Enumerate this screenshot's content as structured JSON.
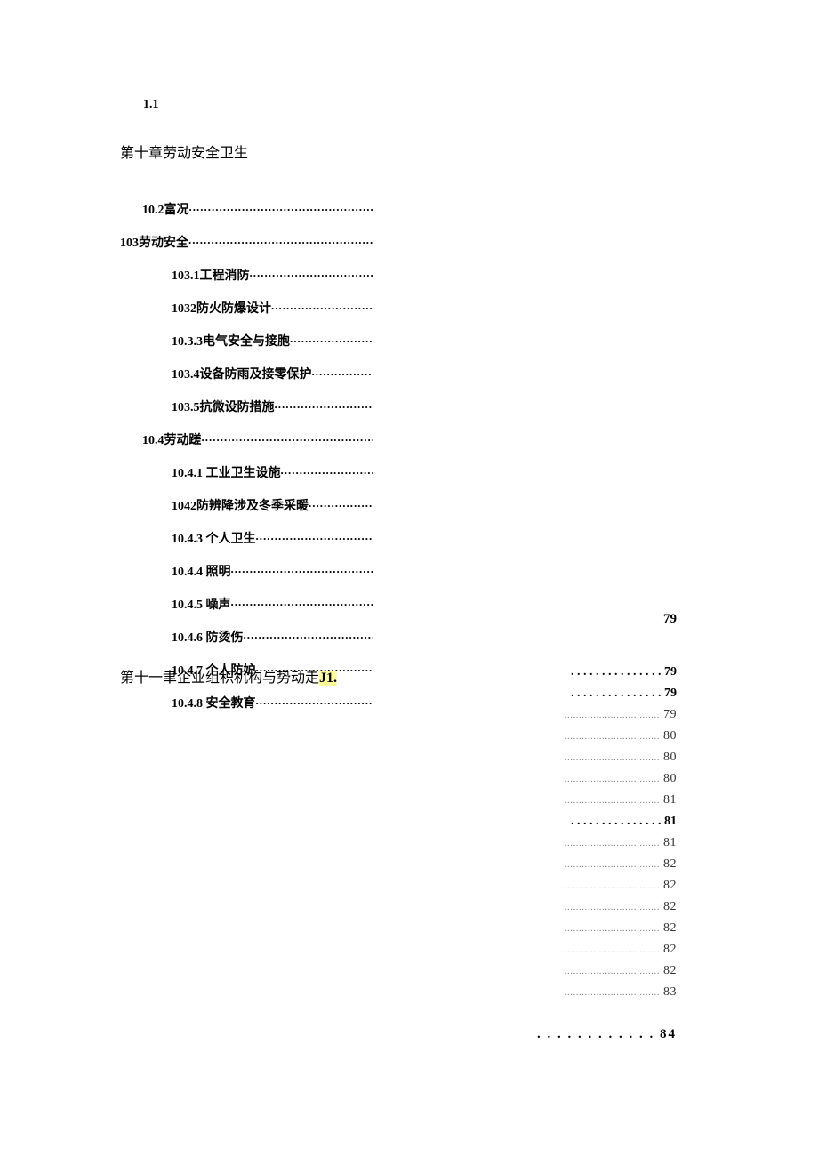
{
  "section_num": "1.1",
  "chapter10_title": "第十章劳动安全卫生",
  "left_items": [
    {
      "indent": 1,
      "label": "10.2富况",
      "dots": "........................................................."
    },
    {
      "indent": 0,
      "label": "103劳动安全",
      "dots": "................................................."
    },
    {
      "indent": 2,
      "label": "103.1工程消防",
      "dots": "......................................."
    },
    {
      "indent": 2,
      "label": "1032防火防爆设计",
      "dots": "..............................."
    },
    {
      "indent": 2,
      "label": "10.3.3电气安全与接胞",
      "dots": "........................"
    },
    {
      "indent": 2,
      "label": "103.4设备防雨及接零保护",
      "dots": ".................."
    },
    {
      "indent": 2,
      "label": "103.5抗微设防措施",
      "dots": "..............................."
    },
    {
      "indent": 1,
      "label": "10.4劳动蹉",
      "dots": "......................................................"
    },
    {
      "indent": 2,
      "label": "10.4.1   工业卫生设施",
      "dots": ".........................."
    },
    {
      "indent": 2,
      "label": "1042防辨降涉及冬季采暖",
      "dots": "..................."
    },
    {
      "indent": 2,
      "label": "10.4.3   个人卫生",
      "dots": "................................."
    },
    {
      "indent": 2,
      "label": "10.4.4   照明",
      "dots": ".........................................."
    },
    {
      "indent": 2,
      "label": "10.4.5   噪声",
      "dots": "..........................................."
    },
    {
      "indent": 2,
      "label": "10.4.6   防烫伤",
      "dots": "......................................"
    },
    {
      "indent": 2,
      "label": "10.4.7   个人防妒",
      "dots": "................................."
    },
    {
      "indent": 2,
      "label": "10.4.8   安全教育",
      "dots": "................................."
    }
  ],
  "chapter11_prefix": "第十一聿企业组积机构与势动走",
  "chapter11_jl": "J1.",
  "page_top_right": "79",
  "right_rows": [
    {
      "style": "bold",
      "dots": ". . . . . . . . . . . . . . .",
      "page": "79"
    },
    {
      "style": "bold",
      "dots": ". . . . . . . . . . . . . . .",
      "page": "79"
    },
    {
      "style": "smalldots",
      "dots": ".................................",
      "page": "79"
    },
    {
      "style": "smalldots",
      "dots": ".................................",
      "page": "80"
    },
    {
      "style": "smalldots",
      "dots": ".................................",
      "page": "80"
    },
    {
      "style": "smalldots",
      "dots": ".................................",
      "page": "80"
    },
    {
      "style": "smalldots",
      "dots": ".................................",
      "page": "81"
    },
    {
      "style": "bold",
      "dots": ". . . . . . . . . . . . . . .",
      "page": "81"
    },
    {
      "style": "smalldots",
      "dots": ".................................",
      "page": "81"
    },
    {
      "style": "smalldots",
      "dots": ".................................",
      "page": "82"
    },
    {
      "style": "smalldots",
      "dots": ".................................",
      "page": "82"
    },
    {
      "style": "smalldots",
      "dots": ".................................",
      "page": "82"
    },
    {
      "style": "smalldots",
      "dots": ".................................",
      "page": "82"
    },
    {
      "style": "smalldots",
      "dots": ".................................",
      "page": "82"
    },
    {
      "style": "smalldots",
      "dots": ".................................",
      "page": "82"
    },
    {
      "style": "smalldots",
      "dots": ".................................",
      "page": "83"
    }
  ],
  "bottom_dots": ". . . . . . . . . . . .",
  "bottom_page": "84"
}
